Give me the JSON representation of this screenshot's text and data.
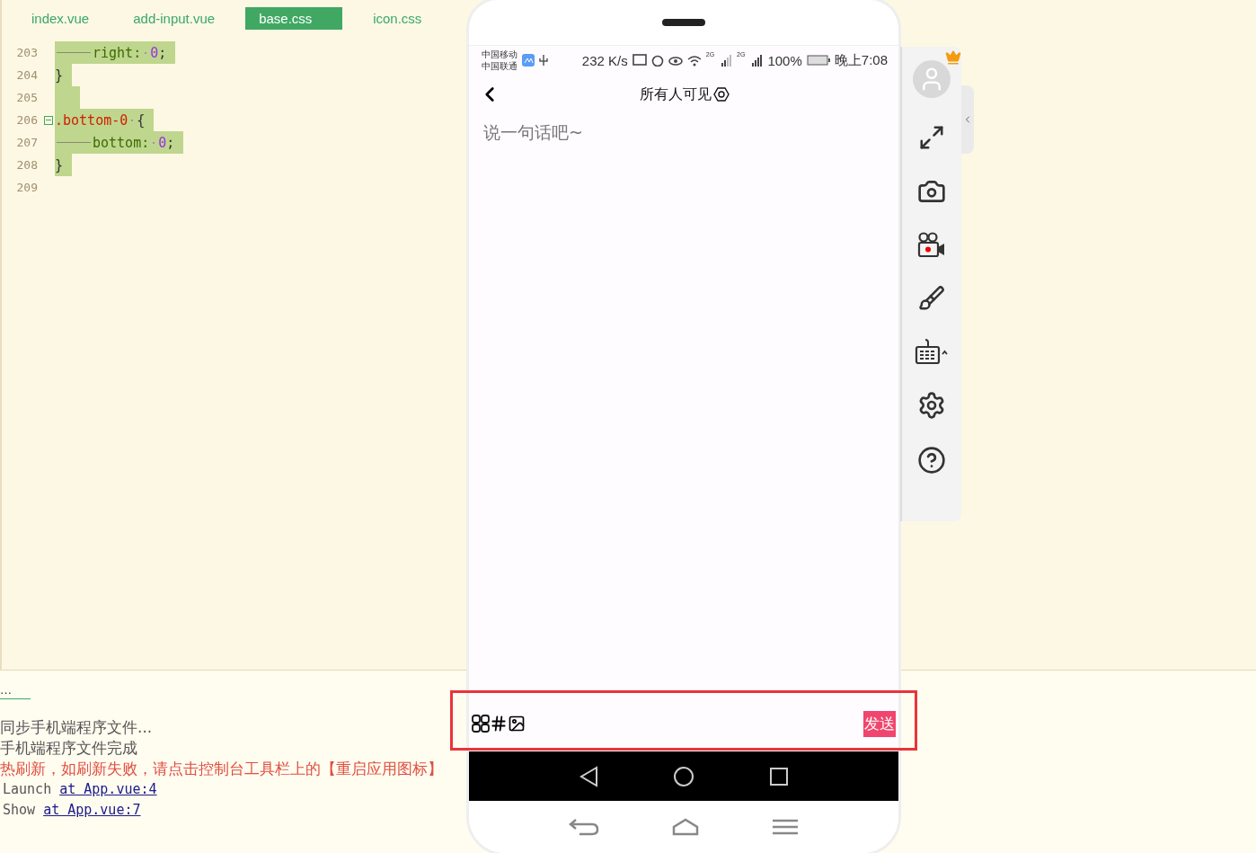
{
  "editor": {
    "tabs": [
      {
        "label": "index.vue",
        "selected": false
      },
      {
        "label": "add-input.vue",
        "selected": false
      },
      {
        "label": "base.css",
        "selected": true
      },
      {
        "label": "icon.css",
        "selected": false
      }
    ],
    "code_lines": [
      {
        "number": "203",
        "highlighted": true,
        "foldable": false,
        "indent": true,
        "tokens": [
          {
            "kind": "property",
            "text": "right:"
          },
          {
            "kind": "space"
          },
          {
            "kind": "number",
            "text": "0"
          },
          {
            "kind": "punct",
            "text": ";"
          }
        ]
      },
      {
        "number": "204",
        "highlighted": true,
        "foldable": false,
        "indent": false,
        "tokens": [
          {
            "kind": "punct",
            "text": "}"
          }
        ]
      },
      {
        "number": "205",
        "highlighted": true,
        "foldable": false,
        "indent": false
      },
      {
        "number": "206",
        "highlighted": true,
        "foldable": true,
        "indent": false,
        "tokens": [
          {
            "kind": "selector",
            "text": ".bottom-0"
          },
          {
            "kind": "space"
          },
          {
            "kind": "punct",
            "text": "{"
          }
        ]
      },
      {
        "number": "207",
        "highlighted": true,
        "foldable": false,
        "indent": true,
        "tokens": [
          {
            "kind": "property",
            "text": "bottom:"
          },
          {
            "kind": "space"
          },
          {
            "kind": "number",
            "text": "0"
          },
          {
            "kind": "punct",
            "text": ";"
          }
        ]
      },
      {
        "number": "208",
        "highlighted": true,
        "foldable": false,
        "indent": false,
        "tokens": [
          {
            "kind": "punct",
            "text": "}"
          }
        ]
      },
      {
        "number": "209",
        "highlighted": false,
        "foldable": false,
        "indent": false
      }
    ]
  },
  "console": {
    "tab": "…",
    "lines": [
      {
        "kind": "plain",
        "text": "同步手机端程序文件..."
      },
      {
        "kind": "plain",
        "text": "手机端程序文件完成"
      },
      {
        "kind": "error",
        "text": "热刷新，如刷新失败，请点击控制台工具栏上的【重启应用图标】"
      },
      {
        "kind": "log",
        "text": "Launch",
        "link": "at App.vue:4"
      },
      {
        "kind": "log",
        "text": "Show",
        "link": "at App.vue:7"
      }
    ]
  },
  "phone": {
    "status_bar": {
      "carriers": [
        "中国移动",
        "中国联通"
      ],
      "speed": "232 K/s",
      "network_labels": [
        "2G",
        "2G"
      ],
      "battery": "100%",
      "time": "晚上7:08"
    },
    "header": {
      "title": "所有人可见"
    },
    "post_input": {
      "placeholder": "说一句话吧~"
    },
    "bottom_bar": {
      "send": "发送",
      "highlighted": true
    }
  }
}
